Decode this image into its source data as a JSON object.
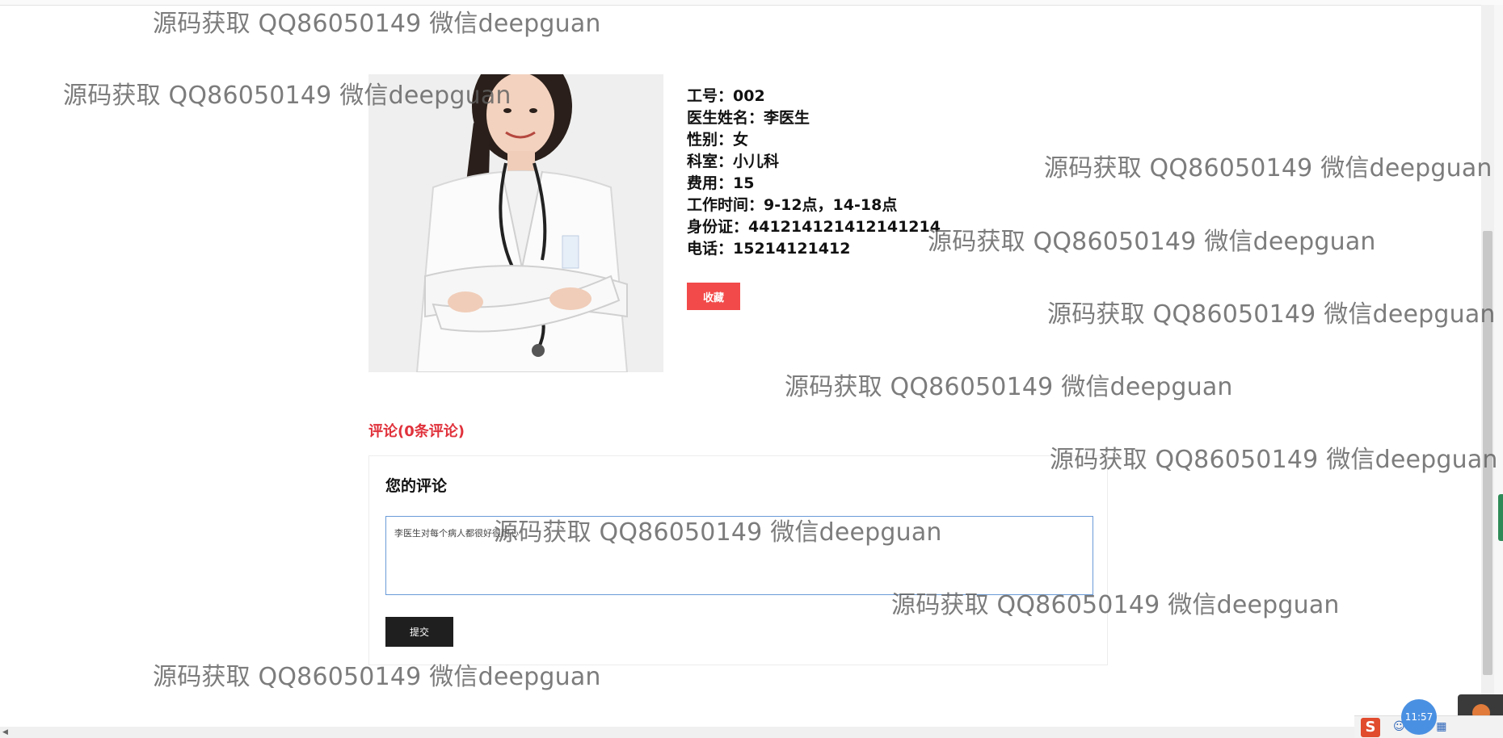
{
  "doctor": {
    "photo_alt": "doctor-photo",
    "lines": [
      "工号：002",
      "医生姓名：李医生",
      "性别：女",
      "科室：小儿科",
      "费用：15",
      "工作时间：9-12点，14-18点",
      "身份证：441214121412141214",
      "电话：15214121412"
    ],
    "favorite_label": "收藏"
  },
  "comments": {
    "title": "评论(0条评论)",
    "heading": "您的评论",
    "input_value": "李医生对每个病人都很好很耐心",
    "submit_label": "提交"
  },
  "watermark_text": "源码获取 QQ86050149 微信deepguan",
  "taskbar": {
    "clock": "11:57",
    "ime_label": "S"
  },
  "colors": {
    "accent_red": "#f24a4a",
    "comment_title_red": "#e0323c",
    "submit_dark": "#1f1f1f",
    "input_border": "#6a9bd8"
  }
}
